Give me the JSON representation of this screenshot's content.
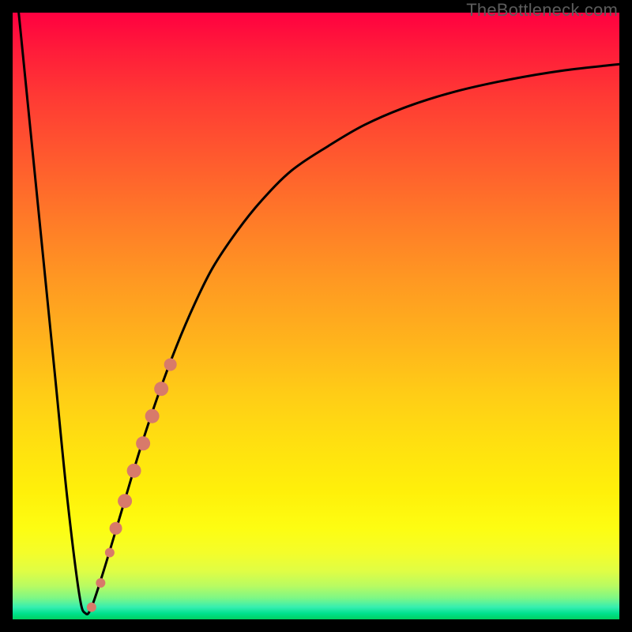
{
  "watermark": "TheBottleneck.com",
  "chart_data": {
    "type": "line",
    "title": "",
    "xlabel": "",
    "ylabel": "",
    "xlim": [
      0,
      100
    ],
    "ylim": [
      0,
      100
    ],
    "grid": false,
    "series": [
      {
        "name": "bottleneck-curve",
        "color": "#000000",
        "x": [
          1,
          3,
          5,
          7,
          9,
          11,
          12,
          13,
          15,
          18,
          21,
          24,
          27,
          30,
          33,
          37,
          41,
          46,
          52,
          58,
          65,
          73,
          82,
          91,
          100
        ],
        "y": [
          100,
          80,
          60,
          40,
          20,
          4,
          1,
          2,
          8,
          18,
          28,
          37,
          45,
          52,
          58,
          64,
          69,
          74,
          78,
          81.5,
          84.5,
          87,
          89,
          90.5,
          91.5
        ]
      }
    ],
    "markers": [
      {
        "x": 13.0,
        "y": 2.0,
        "r": 6,
        "color": "#d87a6a"
      },
      {
        "x": 14.5,
        "y": 6.0,
        "r": 6,
        "color": "#d87a6a"
      },
      {
        "x": 16.0,
        "y": 11.0,
        "r": 6,
        "color": "#d87a6a"
      },
      {
        "x": 17.0,
        "y": 15.0,
        "r": 8,
        "color": "#d87a6a"
      },
      {
        "x": 18.5,
        "y": 19.5,
        "r": 9,
        "color": "#d87a6a"
      },
      {
        "x": 20.0,
        "y": 24.5,
        "r": 9,
        "color": "#d87a6a"
      },
      {
        "x": 21.5,
        "y": 29.0,
        "r": 9,
        "color": "#d87a6a"
      },
      {
        "x": 23.0,
        "y": 33.5,
        "r": 9,
        "color": "#d87a6a"
      },
      {
        "x": 24.5,
        "y": 38.0,
        "r": 9,
        "color": "#d87a6a"
      },
      {
        "x": 26.0,
        "y": 42.0,
        "r": 8,
        "color": "#d87a6a"
      }
    ],
    "gradient_stops": [
      {
        "pos": 0,
        "color": "#ff0040"
      },
      {
        "pos": 0.5,
        "color": "#ffb31c"
      },
      {
        "pos": 0.8,
        "color": "#fff00a"
      },
      {
        "pos": 1.0,
        "color": "#00d060"
      }
    ]
  }
}
